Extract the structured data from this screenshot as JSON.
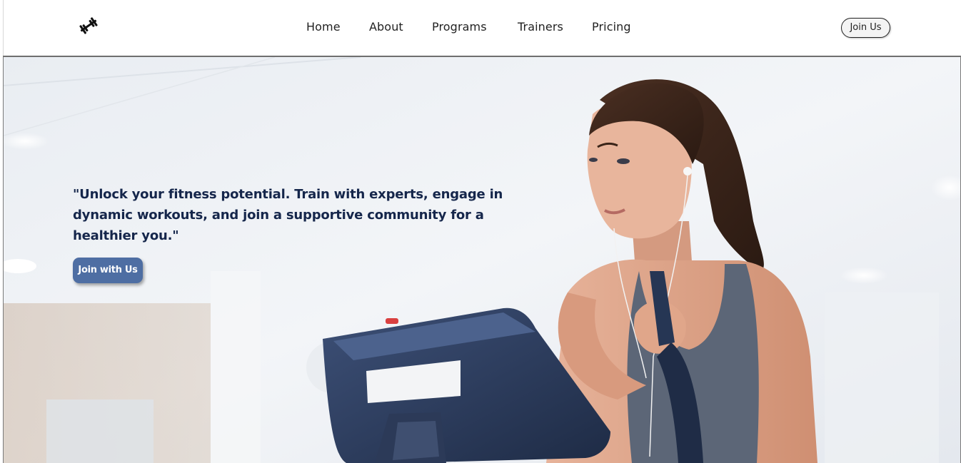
{
  "nav": {
    "logo_icon": "dumbbell-icon",
    "links": [
      {
        "label": "Home"
      },
      {
        "label": "About"
      },
      {
        "label": "Programs"
      },
      {
        "label": "Trainers"
      },
      {
        "label": "Pricing"
      }
    ],
    "join_label": "Join Us"
  },
  "hero": {
    "quote": "\"Unlock your fitness potential. Train with experts, engage in dynamic workouts, and join a supportive community for a healthier you.\"",
    "cta_label": "Join with Us",
    "image_subject": "woman-on-elliptical-trainer"
  },
  "colors": {
    "quote_text": "#15264b",
    "cta_background": "#4e6ea3",
    "nav_text": "#222222"
  }
}
